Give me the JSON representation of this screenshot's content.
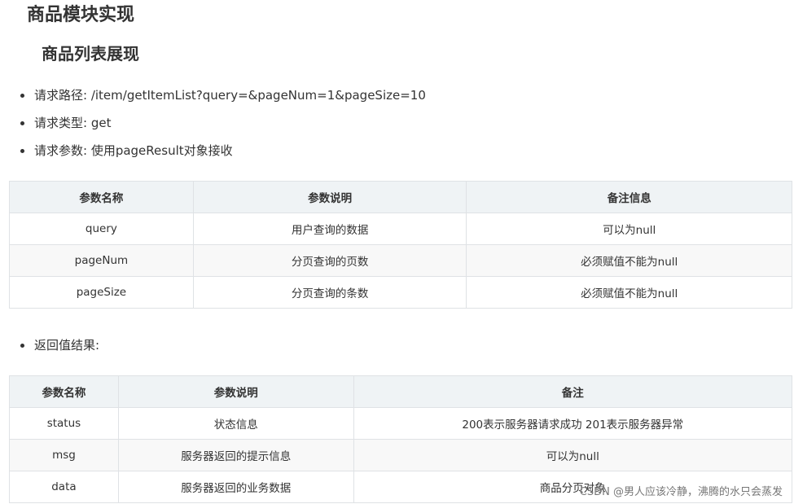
{
  "headings": {
    "module_title": "商品模块实现",
    "section_title": "商品列表展现"
  },
  "request": {
    "items": [
      "请求路径: /item/getItemList?query=&pageNum=1&pageSize=10",
      "请求类型: get",
      "请求参数: 使用pageResult对象接收"
    ]
  },
  "params_table": {
    "headers": [
      "参数名称",
      "参数说明",
      "备注信息"
    ],
    "rows": [
      [
        "query",
        "用户查询的数据",
        "可以为null"
      ],
      [
        "pageNum",
        "分页查询的页数",
        "必须赋值不能为null"
      ],
      [
        "pageSize",
        "分页查询的条数",
        "必须赋值不能为null"
      ]
    ]
  },
  "return": {
    "label": "返回值结果:"
  },
  "return_table": {
    "headers": [
      "参数名称",
      "参数说明",
      "备注"
    ],
    "rows": [
      [
        "status",
        "状态信息",
        "200表示服务器请求成功 201表示服务器异常"
      ],
      [
        "msg",
        "服务器返回的提示信息",
        "可以为null"
      ],
      [
        "data",
        "服务器返回的业务数据",
        "商品分页对象"
      ]
    ]
  },
  "watermark": "CSDN @男人应该冷静，沸腾的水只会蒸发"
}
